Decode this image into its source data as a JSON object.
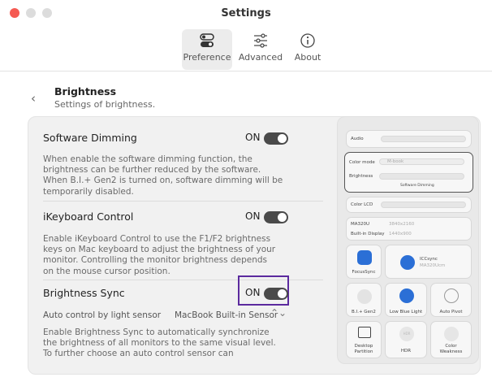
{
  "window": {
    "title": "Settings"
  },
  "toolbar": {
    "items": [
      {
        "label": "Preference",
        "icon": "toggles-icon",
        "active": true
      },
      {
        "label": "Advanced",
        "icon": "sliders-icon",
        "active": false
      },
      {
        "label": "About",
        "icon": "info-icon",
        "active": false
      }
    ]
  },
  "header": {
    "title": "Brightness",
    "subtitle": "Settings of brightness."
  },
  "sections": [
    {
      "title": "Software Dimming",
      "toggle": "ON",
      "description": [
        "When enable the software dimming function, the",
        "brightness can be further reduced by the software.",
        "When B.I.+ Gen2 is turned on, software dimming will be",
        "temporarily disabled."
      ]
    },
    {
      "title": "iKeyboard Control",
      "toggle": "ON",
      "description": [
        "Enable iKeyboard Control to use the F1/F2 brightness",
        "keys on Mac keyboard to adjust the brightness of your",
        "monitor. Controlling the monitor brightness depends",
        "on the mouse cursor position."
      ]
    },
    {
      "title": "Brightness Sync",
      "toggle": "ON",
      "sensor_label": "Auto control by light sensor",
      "sensor_value": "MacBook Built-in Sensor",
      "description": [
        "Enable Brightness Sync to automatically synchronize",
        "the brightness of all monitors to the same visual level.",
        "To further choose an auto control sensor can"
      ]
    }
  ],
  "mockup": {
    "audio": "Audio",
    "color_mode": "Color mode",
    "color_mode_value": "M-book",
    "brightness": "Brightness",
    "software_dimming": "Software Dimming",
    "color_lcd": "Color LCD",
    "monitor1": "MA320U",
    "monitor1_res": "3840x2160",
    "monitor2": "Built-in Display",
    "monitor2_res": "1440x900",
    "focussync": "FocusSync",
    "iccsync": "ICCsync",
    "iccsync_sub": "MA320Ucm",
    "tiles": [
      "B.I.+ Gen2",
      "Low Blue Light",
      "Auto Pivot",
      "Desktop Partition",
      "HDR",
      "Color Weakness"
    ],
    "hdr_icon_text": "HDR",
    "accent": "#2b6fd6"
  }
}
